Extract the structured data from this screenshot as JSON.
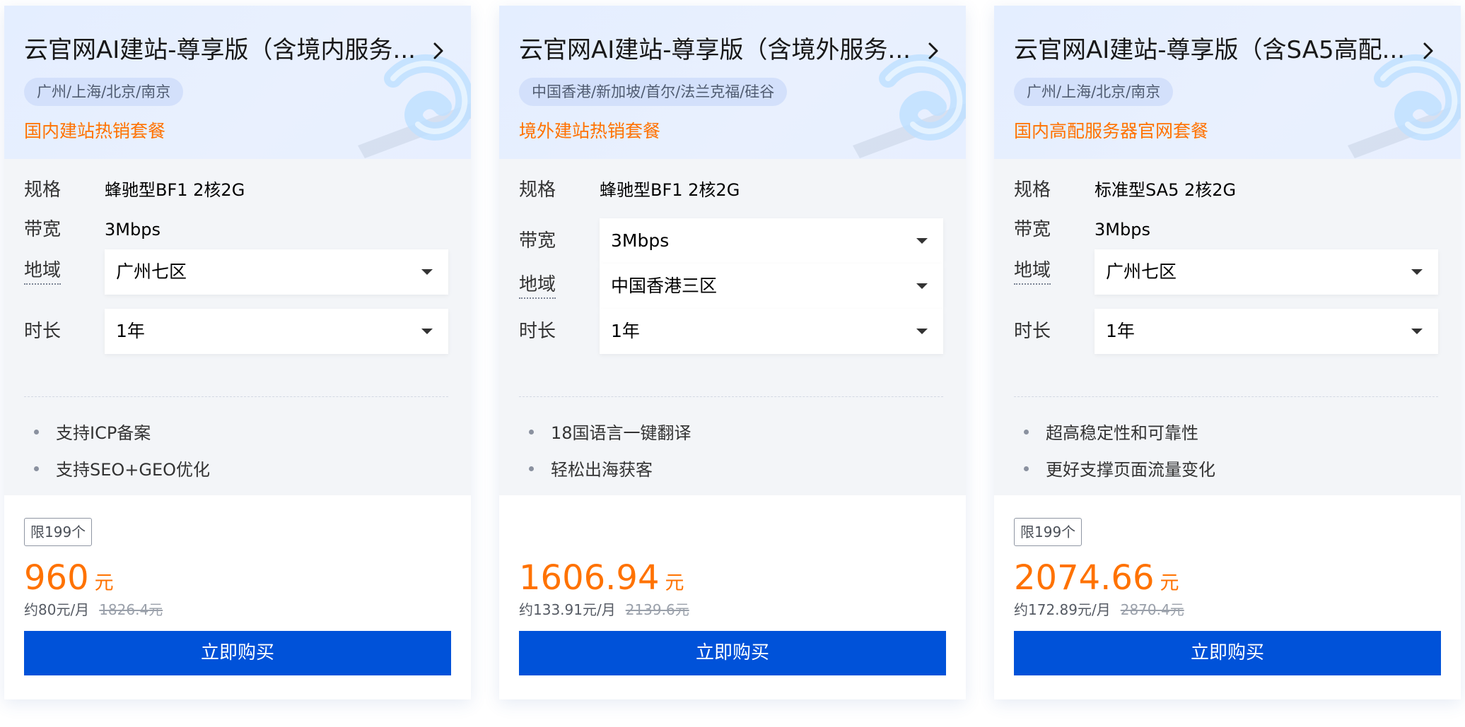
{
  "colors": {
    "accent": "#ff7200",
    "primary": "#0052d9",
    "header_bg": "#e4eeff",
    "body_bg": "#f3f5f8"
  },
  "icons": {
    "title_arrow": "chevron-right-icon",
    "select_caret": "caret-down-icon"
  },
  "cards": [
    {
      "title": "云官网AI建站-尊享版（含境内服务...",
      "regions": "广州/上海/北京/南京",
      "tagline": "国内建站热销套餐",
      "spec_label": "规格",
      "spec_value": "蜂驰型BF1 2核2G",
      "bandwidth_label": "带宽",
      "bandwidth_value": "3Mbps",
      "region_label": "地域",
      "region_value": "广州七区",
      "duration_label": "时长",
      "duration_value": "1年",
      "features": [
        "支持ICP备案",
        "支持SEO+GEO优化"
      ],
      "limit": "限199个",
      "price": "960",
      "price_unit": "元",
      "monthly": "约80元/月",
      "original_price": "1826.4元",
      "buy_label": "立即购买"
    },
    {
      "title": "云官网AI建站-尊享版（含境外服务...",
      "regions": "中国香港/新加坡/首尔/法兰克福/硅谷",
      "tagline": "境外建站热销套餐",
      "spec_label": "规格",
      "spec_value": "蜂驰型BF1 2核2G",
      "bandwidth_label": "带宽",
      "bandwidth_value": "3Mbps",
      "region_label": "地域",
      "region_value": "中国香港三区",
      "duration_label": "时长",
      "duration_value": "1年",
      "features": [
        "18国语言一键翻译",
        "轻松出海获客"
      ],
      "limit": "",
      "price": "1606.94",
      "price_unit": "元",
      "monthly": "约133.91元/月",
      "original_price": "2139.6元",
      "buy_label": "立即购买"
    },
    {
      "title": "云官网AI建站-尊享版（含SA5高配...",
      "regions": "广州/上海/北京/南京",
      "tagline": "国内高配服务器官网套餐",
      "spec_label": "规格",
      "spec_value": "标准型SA5 2核2G",
      "bandwidth_label": "带宽",
      "bandwidth_value": "3Mbps",
      "region_label": "地域",
      "region_value": "广州七区",
      "duration_label": "时长",
      "duration_value": "1年",
      "features": [
        "超高稳定性和可靠性",
        "更好支撑页面流量变化"
      ],
      "limit": "限199个",
      "price": "2074.66",
      "price_unit": "元",
      "monthly": "约172.89元/月",
      "original_price": "2870.4元",
      "buy_label": "立即购买"
    }
  ]
}
